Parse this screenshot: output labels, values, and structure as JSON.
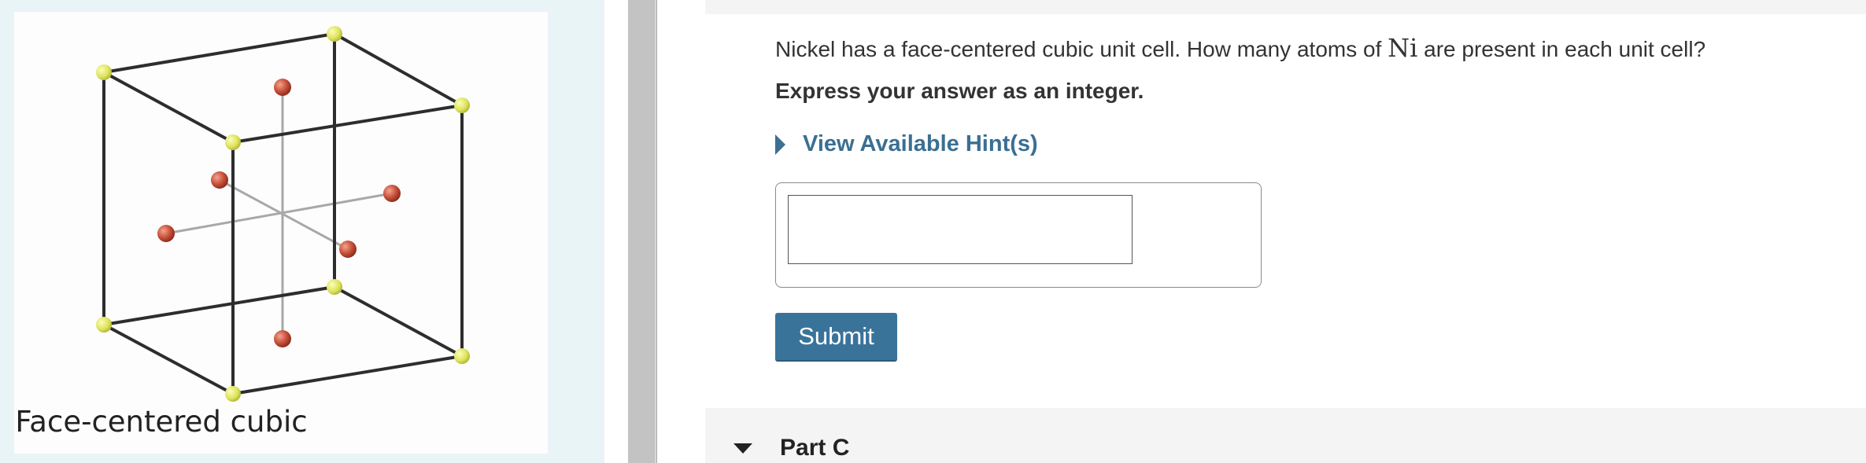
{
  "figure": {
    "caption": "Face-centered cubic",
    "corner_atom_color": "#e6ec66",
    "face_atom_color": "#c9513b"
  },
  "question": {
    "text_before": "Nickel has a face-centered cubic unit cell. How many atoms of ",
    "math": "Ni",
    "text_after": " are present in each unit cell?",
    "instruction": "Express your answer as an integer."
  },
  "hints": {
    "label": "View Available Hint(s)"
  },
  "answer": {
    "value": "",
    "placeholder": ""
  },
  "actions": {
    "submit_label": "Submit"
  },
  "next_part": {
    "title": "Part C"
  },
  "colors": {
    "accent": "#3a739a",
    "left_panel_bg": "#e9f4f6",
    "splitter": "#c3c3c3"
  }
}
